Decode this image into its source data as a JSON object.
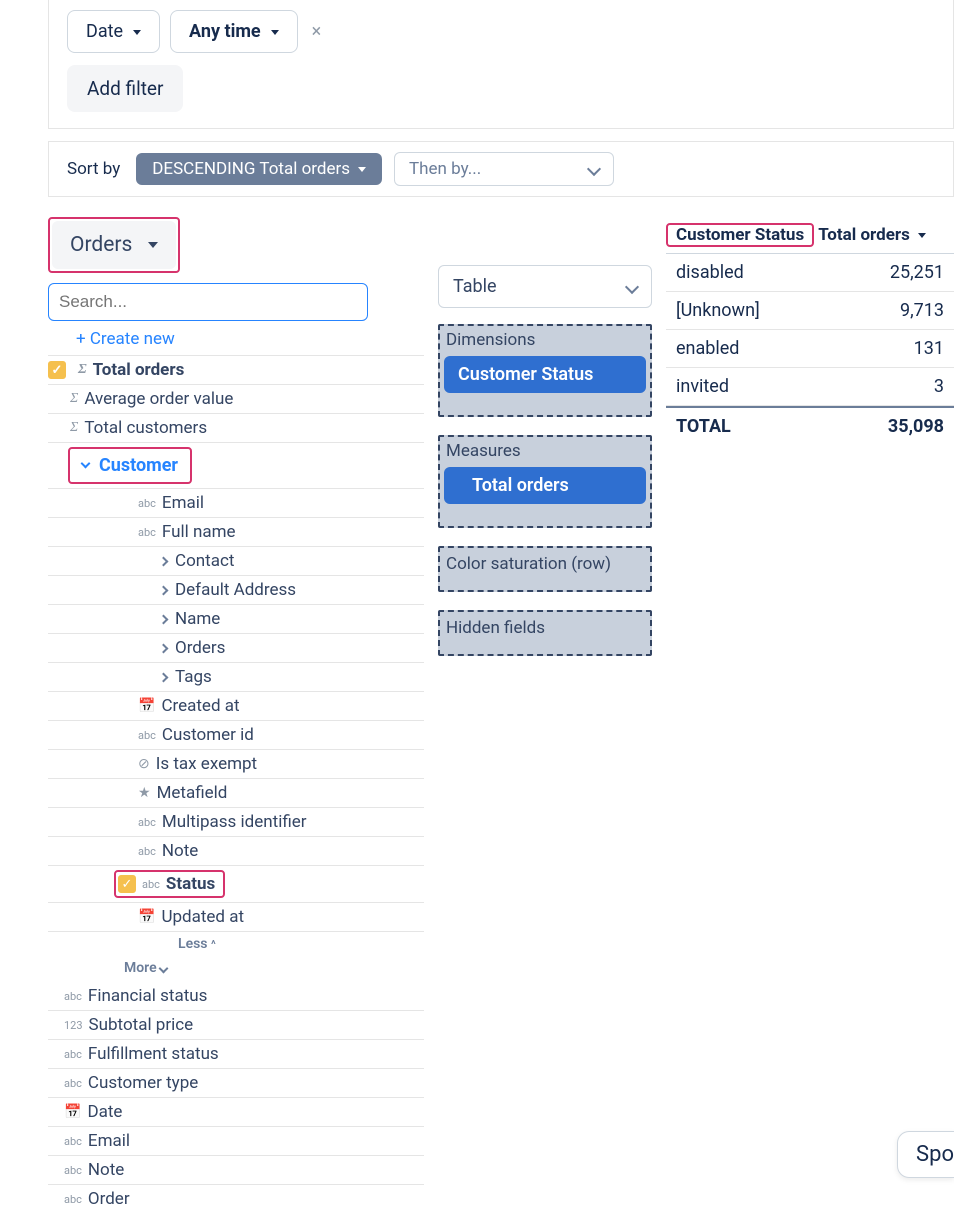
{
  "filters": {
    "date_label": "Date",
    "any_time_label": "Any time",
    "add_filter_label": "Add filter"
  },
  "sort": {
    "label": "Sort by",
    "primary": "DESCENDING Total orders",
    "then_placeholder": "Then by..."
  },
  "source_button": "Orders",
  "search_placeholder": "Search...",
  "create_new": "+ Create new",
  "measures": [
    {
      "label": "Total orders",
      "checked": true,
      "bold": true
    },
    {
      "label": "Average order value",
      "checked": false,
      "bold": false
    },
    {
      "label": "Total customers",
      "checked": false,
      "bold": false
    }
  ],
  "customer_section": {
    "header": "Customer",
    "fields_top": [
      {
        "icon": "abc",
        "label": "Email"
      },
      {
        "icon": "abc",
        "label": "Full name"
      }
    ],
    "subgroups": [
      {
        "label": "Contact"
      },
      {
        "label": "Default Address"
      },
      {
        "label": "Name"
      },
      {
        "label": "Orders"
      },
      {
        "label": "Tags"
      }
    ],
    "fields_mid": [
      {
        "icon": "cal",
        "label": "Created at"
      },
      {
        "icon": "abc",
        "label": "Customer id"
      },
      {
        "icon": "chk",
        "label": "Is tax exempt"
      },
      {
        "icon": "star",
        "label": "Metafield"
      },
      {
        "icon": "abc",
        "label": "Multipass identifier"
      },
      {
        "icon": "abc",
        "label": "Note"
      }
    ],
    "status": {
      "icon": "abc",
      "label": "Status",
      "checked": true,
      "bold": true
    },
    "fields_bot": [
      {
        "icon": "cal",
        "label": "Updated at"
      }
    ],
    "less": "Less",
    "more": "More"
  },
  "bottom_fields": [
    {
      "icon": "abc",
      "label": "Financial status"
    },
    {
      "icon": "123",
      "label": "Subtotal price"
    },
    {
      "icon": "abc",
      "label": "Fulfillment status"
    },
    {
      "icon": "abc",
      "label": "Customer type"
    },
    {
      "icon": "cal",
      "label": "Date"
    },
    {
      "icon": "abc",
      "label": "Email"
    },
    {
      "icon": "abc",
      "label": "Note"
    },
    {
      "icon": "abc",
      "label": "Order"
    }
  ],
  "vis_type": "Table",
  "dropzones": {
    "dimensions": {
      "title": "Dimensions",
      "pill": "Customer Status"
    },
    "measures": {
      "title": "Measures",
      "pill": "Total orders"
    },
    "color": {
      "title": "Color saturation (row)"
    },
    "hidden": {
      "title": "Hidden fields"
    }
  },
  "results": {
    "col1": "Customer Status",
    "col2": "Total orders",
    "rows": [
      {
        "k": "disabled",
        "v": "25,251"
      },
      {
        "k": "[Unknown]",
        "v": "9,713"
      },
      {
        "k": "enabled",
        "v": "131"
      },
      {
        "k": "invited",
        "v": "3"
      }
    ],
    "total_label": "TOTAL",
    "total_value": "35,098"
  },
  "chart_data": {
    "type": "table",
    "title": "",
    "columns": [
      "Customer Status",
      "Total orders"
    ],
    "rows": [
      [
        "disabled",
        25251
      ],
      [
        "[Unknown]",
        9713
      ],
      [
        "enabled",
        131
      ],
      [
        "invited",
        3
      ]
    ],
    "total": 35098
  },
  "bottom_button": "Spo"
}
